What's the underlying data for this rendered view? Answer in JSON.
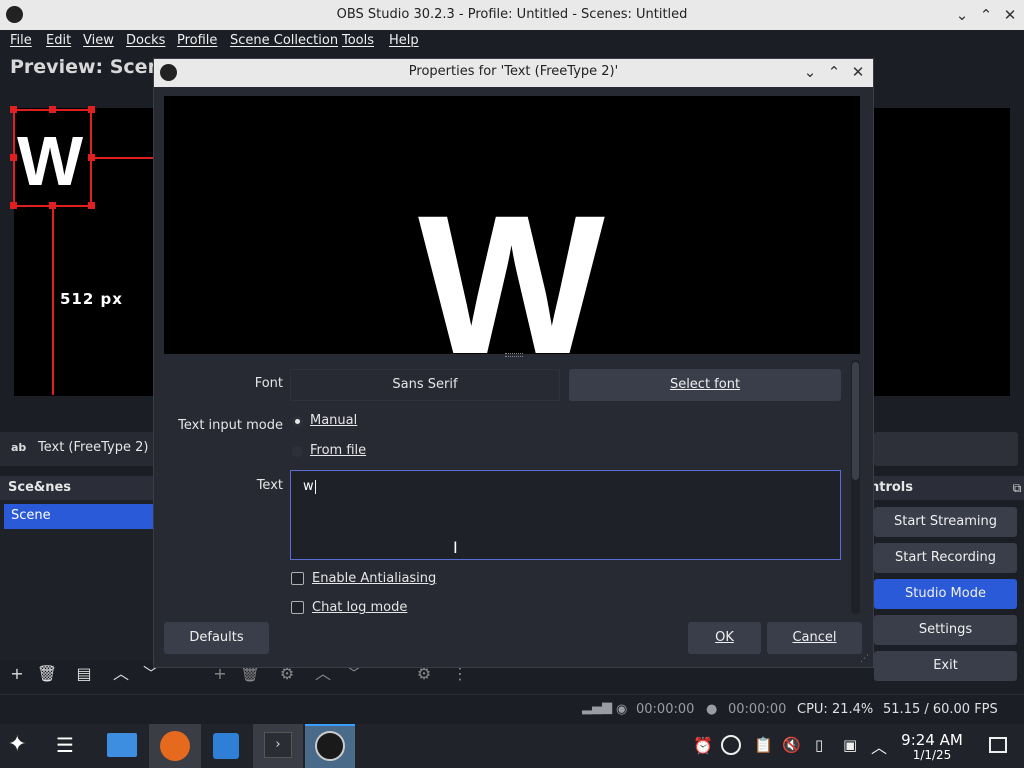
{
  "window": {
    "title": "OBS Studio 30.2.3 - Profile: Untitled - Scenes: Untitled"
  },
  "menu": [
    "File",
    "Edit",
    "View",
    "Docks",
    "Profile",
    "Scene Collection",
    "Tools",
    "Help"
  ],
  "preview": {
    "label": "Preview: Scene",
    "glyph": "W",
    "size_label": "512  px"
  },
  "source": {
    "icon_text": "ab",
    "name": "Text (FreeType 2)"
  },
  "scenes": {
    "title": "Sce&nes",
    "items": [
      "Scene"
    ]
  },
  "controls": {
    "title": "ntrols",
    "buttons": [
      "Start Streaming",
      "Start Recording",
      "Studio Mode",
      "Settings",
      "Exit"
    ],
    "active": "Studio Mode"
  },
  "status": {
    "stream_time": "00:00:00",
    "rec_time": "00:00:00",
    "cpu": "CPU: 21.4%",
    "fps": "51.15 / 60.00 FPS"
  },
  "clock": {
    "time": "9:24 AM",
    "date": "1/1/25"
  },
  "dialog": {
    "title": "Properties for 'Text (FreeType 2)'",
    "preview_glyph": "W",
    "font_label": "Font",
    "font_value": "Sans Serif",
    "select_font_label": "Select font",
    "text_input_mode_label": "Text input mode",
    "mode_options": [
      "Manual",
      "From file"
    ],
    "mode_selected": "Manual",
    "text_label": "Text",
    "text_value": "w",
    "checkboxes": [
      {
        "label": "Enable Antialiasing",
        "checked": false
      },
      {
        "label": "Chat log mode",
        "checked": false
      }
    ],
    "defaults_label": "Defaults",
    "ok_label": "OK",
    "cancel_label": "Cancel"
  },
  "colors": {
    "accent": "#2a5ad7",
    "selection_red": "#e02020",
    "bg": "#1c1e26"
  }
}
